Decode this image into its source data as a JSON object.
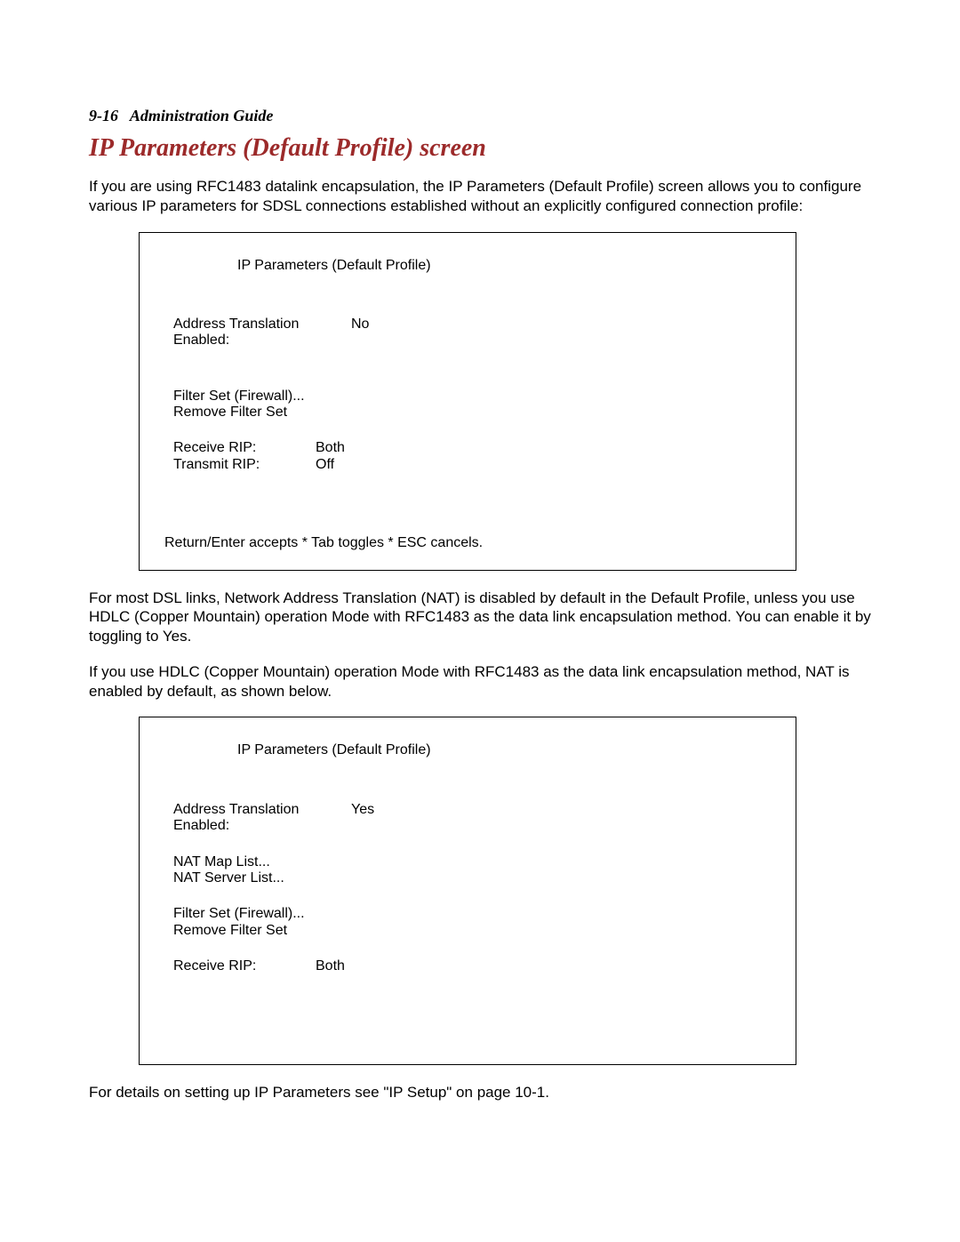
{
  "header": {
    "page_ref": "9-16",
    "guide_name": "Administration Guide"
  },
  "section_title": "IP Parameters (Default Profile) screen",
  "para1": "If you are using RFC1483 datalink encapsulation, the IP Parameters (Default Profile) screen allows you to configure various IP parameters for SDSL connections established without an explicitly configured connection profile:",
  "terminal1": {
    "title": "IP Parameters (Default Profile)",
    "rows": {
      "addr_trans_label": "Address Translation Enabled:",
      "addr_trans_value": "No",
      "filter_set": "Filter Set (Firewall)...",
      "remove_filter": "Remove Filter Set",
      "receive_rip_label": "Receive RIP:",
      "receive_rip_value": "Both",
      "transmit_rip_label": "Transmit RIP:",
      "transmit_rip_value": "Off"
    },
    "footer": "Return/Enter accepts * Tab toggles * ESC cancels."
  },
  "para2": "For most DSL links, Network Address Translation (NAT) is disabled by default in the Default Profile, unless you use HDLC (Copper Mountain) operation Mode with RFC1483 as the data link encapsulation method. You can enable it by toggling to Yes.",
  "para3": "If you use HDLC (Copper Mountain) operation Mode with RFC1483 as the data link encapsulation method, NAT is enabled by default, as shown below.",
  "terminal2": {
    "title": "IP Parameters (Default Profile)",
    "rows": {
      "addr_trans_label": "Address Translation Enabled:",
      "addr_trans_value": "Yes",
      "nat_map": "NAT Map List...",
      "nat_server": "NAT Server List...",
      "filter_set": "Filter Set (Firewall)...",
      "remove_filter": "Remove Filter Set",
      "receive_rip_label": "Receive RIP:",
      "receive_rip_value": "Both"
    }
  },
  "para4": "For details on setting up IP Parameters see \"IP Setup\" on page 10-1."
}
